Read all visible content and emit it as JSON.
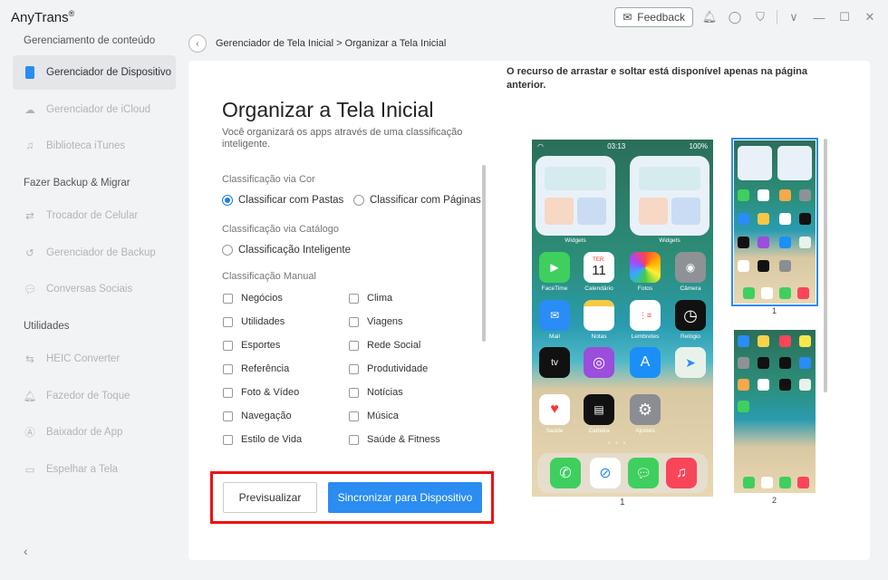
{
  "app": {
    "name": "AnyTrans",
    "reg": "®"
  },
  "titlebar": {
    "feedback_label": "Feedback"
  },
  "sidebar": {
    "section1": "Gerenciamento de conteúdo",
    "section2": "Fazer Backup & Migrar",
    "section3": "Utilidades",
    "items": [
      {
        "label": "Gerenciador de Dispositivo"
      },
      {
        "label": "Gerenciador de iCloud"
      },
      {
        "label": "Biblioteca iTunes"
      },
      {
        "label": "Trocador de Celular"
      },
      {
        "label": "Gerenciador de Backup"
      },
      {
        "label": "Conversas Sociais"
      },
      {
        "label": "HEIC Converter"
      },
      {
        "label": "Fazedor de Toque"
      },
      {
        "label": "Baixador de App"
      },
      {
        "label": "Espelhar a Tela"
      }
    ]
  },
  "breadcrumb": {
    "text": "Gerenciador de Tela Inicial > Organizar a Tela Inicial"
  },
  "main": {
    "title": "Organizar a Tela Inicial",
    "desc": "Você organizará os apps através de uma classificação inteligente.",
    "color_label": "Classificação via Cor",
    "radio_folders": "Classificar com Pastas",
    "radio_pages": "Classificar com Páginas",
    "catalog_label": "Classificação via Catálogo",
    "radio_smart": "Classificação Inteligente",
    "manual_label": "Classificação Manual",
    "categories_left": [
      "Negócios",
      "Utilidades",
      "Esportes",
      "Referência",
      "Foto & Vídeo",
      "Navegação",
      "Estilo de Vida"
    ],
    "categories_right": [
      "Clima",
      "Viagens",
      "Rede Social",
      "Produtividade",
      "Notícias",
      "Música",
      "Saúde & Fitness"
    ],
    "btn_preview": "Previsualizar",
    "btn_sync": "Sincronizar para Dispositivo",
    "drag_note": "O recurso de arrastar e soltar está disponível apenas na página anterior."
  },
  "phone": {
    "time": "03:13",
    "battery": "100%",
    "widget_label": "Widgets",
    "calendar_day": "TER.",
    "calendar_date": "11",
    "apps": [
      "FaceTime",
      "Calendário",
      "Fotos",
      "Câmera",
      "Mail",
      "Notas",
      "Lembretes",
      "Relógio",
      "",
      "",
      "",
      "",
      "Saúde",
      "Carteira",
      "Ajustes"
    ],
    "page_num": "1"
  },
  "thumbs": {
    "page1": "1",
    "page2": "2"
  },
  "colors": {
    "accent": "#2b8cf2",
    "highlight": "#ee1111"
  }
}
